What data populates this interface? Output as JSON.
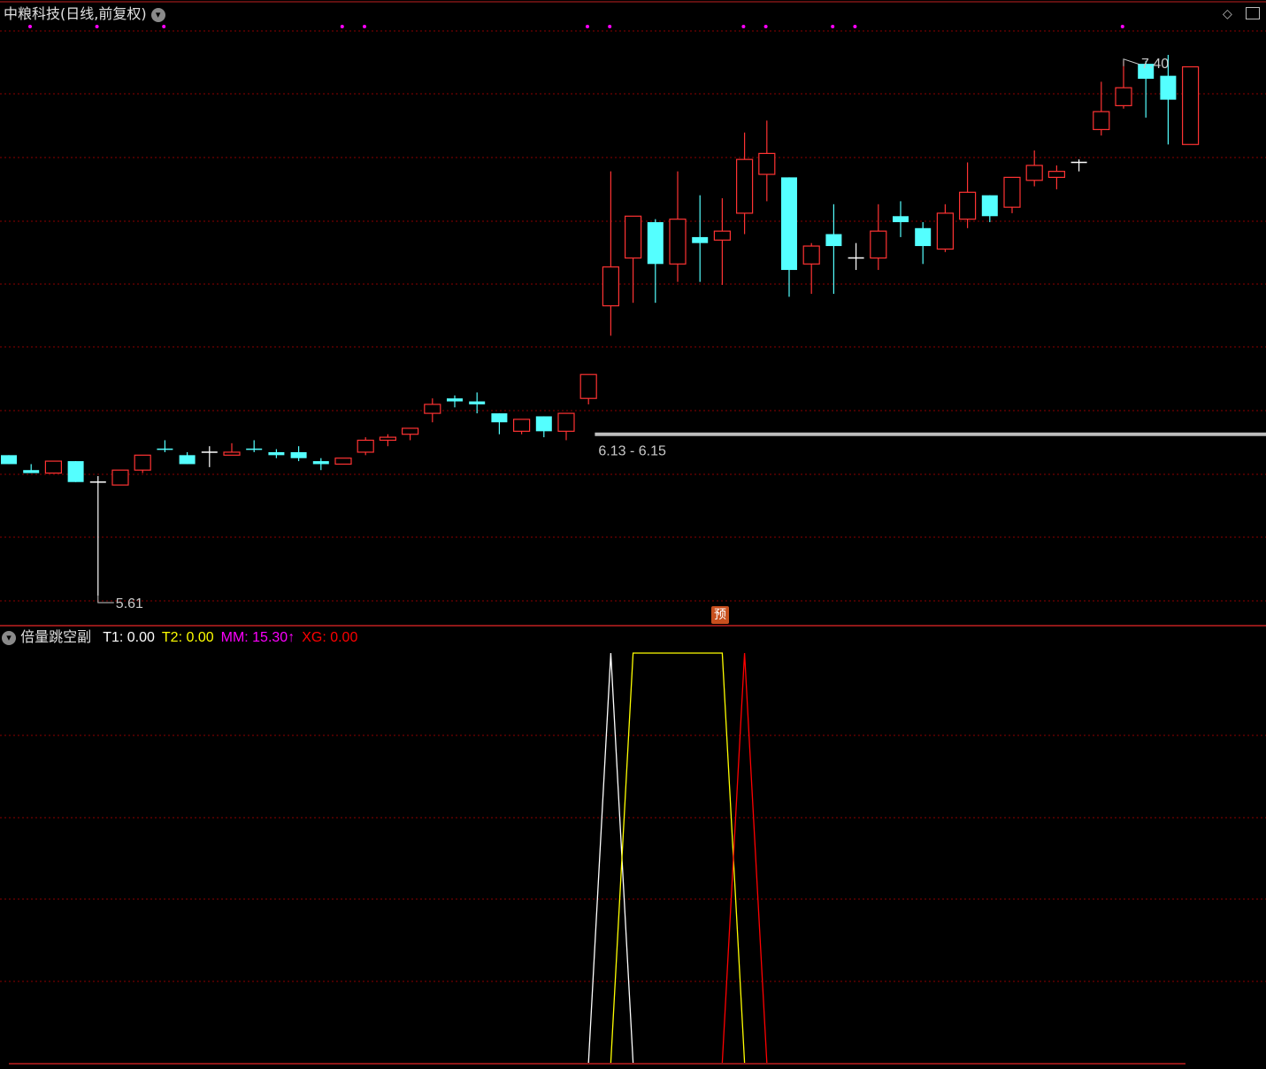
{
  "header": {
    "title": "中粮科技(日线,前复权)",
    "menu_icon": "chevron-down-icon",
    "right_icons": [
      "diamond-icon",
      "window-icon"
    ]
  },
  "indicator": {
    "name": "倍量跳空副",
    "items": [
      {
        "label": "T1",
        "value": "0.00",
        "color": "#ffffff"
      },
      {
        "label": "T2",
        "value": "0.00",
        "color": "#ffff00"
      },
      {
        "label": "MM",
        "value": "15.30",
        "color": "#ff00ff",
        "arrow": "↑"
      },
      {
        "label": "XG",
        "value": "0.00",
        "color": "#ff0000"
      }
    ]
  },
  "prediction_badge": "预",
  "colors": {
    "up": "#ff3333",
    "down": "#54ffff",
    "doji": "#ffffff",
    "grid": "#8b0000",
    "border": "#c02020",
    "support": "#bdbdbd",
    "dots": "#ff00ff"
  },
  "chart_data": [
    {
      "type": "candlestick",
      "title": "中粮科技(日线,前复权)",
      "annotations": [
        {
          "text": "5.61",
          "kind": "low"
        },
        {
          "text": "7.40",
          "kind": "high"
        },
        {
          "text": "6.13 - 6.15",
          "kind": "gap-support"
        }
      ],
      "support_level": 6.15,
      "ylim": [
        5.53,
        7.5
      ],
      "signal_dot_indices": [
        0,
        3,
        6,
        14,
        15,
        25,
        26,
        32,
        33,
        36,
        37,
        49
      ],
      "candles": [
        {
          "o": 6.08,
          "h": 6.08,
          "l": 6.05,
          "c": 6.05,
          "color": "down"
        },
        {
          "o": 6.03,
          "h": 6.05,
          "l": 6.02,
          "c": 6.02,
          "color": "down"
        },
        {
          "o": 6.02,
          "h": 6.06,
          "l": 6.02,
          "c": 6.06,
          "color": "up"
        },
        {
          "o": 6.06,
          "h": 6.06,
          "l": 5.99,
          "c": 5.99,
          "color": "down"
        },
        {
          "o": 5.99,
          "h": 6.01,
          "l": 5.61,
          "c": 5.99,
          "color": "doji"
        },
        {
          "o": 5.98,
          "h": 6.03,
          "l": 5.98,
          "c": 6.03,
          "color": "up"
        },
        {
          "o": 6.03,
          "h": 6.08,
          "l": 6.02,
          "c": 6.08,
          "color": "up"
        },
        {
          "o": 6.1,
          "h": 6.13,
          "l": 6.09,
          "c": 6.1,
          "color": "down"
        },
        {
          "o": 6.08,
          "h": 6.09,
          "l": 6.05,
          "c": 6.05,
          "color": "down"
        },
        {
          "o": 6.09,
          "h": 6.11,
          "l": 6.04,
          "c": 6.09,
          "color": "doji"
        },
        {
          "o": 6.08,
          "h": 6.12,
          "l": 6.08,
          "c": 6.09,
          "color": "up"
        },
        {
          "o": 6.1,
          "h": 6.13,
          "l": 6.09,
          "c": 6.1,
          "color": "down"
        },
        {
          "o": 6.09,
          "h": 6.1,
          "l": 6.07,
          "c": 6.08,
          "color": "down"
        },
        {
          "o": 6.09,
          "h": 6.11,
          "l": 6.06,
          "c": 6.07,
          "color": "down"
        },
        {
          "o": 6.06,
          "h": 6.07,
          "l": 6.03,
          "c": 6.05,
          "color": "down"
        },
        {
          "o": 6.05,
          "h": 6.07,
          "l": 6.05,
          "c": 6.07,
          "color": "up"
        },
        {
          "o": 6.09,
          "h": 6.14,
          "l": 6.08,
          "c": 6.13,
          "color": "up"
        },
        {
          "o": 6.13,
          "h": 6.15,
          "l": 6.11,
          "c": 6.14,
          "color": "up"
        },
        {
          "o": 6.15,
          "h": 6.17,
          "l": 6.13,
          "c": 6.17,
          "color": "up"
        },
        {
          "o": 6.22,
          "h": 6.27,
          "l": 6.19,
          "c": 6.25,
          "color": "up"
        },
        {
          "o": 6.27,
          "h": 6.28,
          "l": 6.24,
          "c": 6.26,
          "color": "down"
        },
        {
          "o": 6.26,
          "h": 6.29,
          "l": 6.22,
          "c": 6.25,
          "color": "down"
        },
        {
          "o": 6.22,
          "h": 6.22,
          "l": 6.15,
          "c": 6.19,
          "color": "down"
        },
        {
          "o": 6.16,
          "h": 6.2,
          "l": 6.15,
          "c": 6.2,
          "color": "up"
        },
        {
          "o": 6.21,
          "h": 6.21,
          "l": 6.14,
          "c": 6.16,
          "color": "down"
        },
        {
          "o": 6.16,
          "h": 6.22,
          "l": 6.13,
          "c": 6.22,
          "color": "up"
        },
        {
          "o": 6.27,
          "h": 6.35,
          "l": 6.25,
          "c": 6.35,
          "color": "up"
        },
        {
          "o": 6.58,
          "h": 7.03,
          "l": 6.48,
          "c": 6.71,
          "color": "up"
        },
        {
          "o": 6.74,
          "h": 6.86,
          "l": 6.59,
          "c": 6.88,
          "color": "up"
        },
        {
          "o": 6.86,
          "h": 6.87,
          "l": 6.59,
          "c": 6.72,
          "color": "down"
        },
        {
          "o": 6.72,
          "h": 7.03,
          "l": 6.66,
          "c": 6.87,
          "color": "up"
        },
        {
          "o": 6.81,
          "h": 6.95,
          "l": 6.66,
          "c": 6.79,
          "color": "down"
        },
        {
          "o": 6.8,
          "h": 6.94,
          "l": 6.65,
          "c": 6.83,
          "color": "up"
        },
        {
          "o": 6.89,
          "h": 7.16,
          "l": 6.82,
          "c": 7.07,
          "color": "up"
        },
        {
          "o": 7.09,
          "h": 7.2,
          "l": 6.93,
          "c": 7.02,
          "color": "up"
        },
        {
          "o": 7.01,
          "h": 7.01,
          "l": 6.61,
          "c": 6.7,
          "color": "down"
        },
        {
          "o": 6.72,
          "h": 6.79,
          "l": 6.62,
          "c": 6.78,
          "color": "up"
        },
        {
          "o": 6.82,
          "h": 6.92,
          "l": 6.62,
          "c": 6.78,
          "color": "down"
        },
        {
          "o": 6.74,
          "h": 6.79,
          "l": 6.7,
          "c": 6.74,
          "color": "doji"
        },
        {
          "o": 6.74,
          "h": 6.92,
          "l": 6.7,
          "c": 6.83,
          "color": "up"
        },
        {
          "o": 6.88,
          "h": 6.93,
          "l": 6.81,
          "c": 6.86,
          "color": "down"
        },
        {
          "o": 6.84,
          "h": 6.86,
          "l": 6.72,
          "c": 6.78,
          "color": "down"
        },
        {
          "o": 6.77,
          "h": 6.92,
          "l": 6.76,
          "c": 6.89,
          "color": "up"
        },
        {
          "o": 6.87,
          "h": 7.06,
          "l": 6.84,
          "c": 6.96,
          "color": "up"
        },
        {
          "o": 6.95,
          "h": 6.95,
          "l": 6.86,
          "c": 6.88,
          "color": "down"
        },
        {
          "o": 6.91,
          "h": 7.01,
          "l": 6.89,
          "c": 7.01,
          "color": "up"
        },
        {
          "o": 7.0,
          "h": 7.1,
          "l": 6.98,
          "c": 7.05,
          "color": "up"
        },
        {
          "o": 7.01,
          "h": 7.05,
          "l": 6.97,
          "c": 7.03,
          "color": "up"
        },
        {
          "o": 7.06,
          "h": 7.07,
          "l": 7.03,
          "c": 7.06,
          "color": "doji"
        },
        {
          "o": 7.17,
          "h": 7.33,
          "l": 7.15,
          "c": 7.23,
          "color": "up"
        },
        {
          "o": 7.25,
          "h": 7.4,
          "l": 7.24,
          "c": 7.31,
          "color": "up"
        },
        {
          "o": 7.39,
          "h": 7.4,
          "l": 7.21,
          "c": 7.34,
          "color": "down"
        },
        {
          "o": 7.35,
          "h": 7.42,
          "l": 7.12,
          "c": 7.27,
          "color": "down"
        },
        {
          "o": 7.12,
          "h": 7.28,
          "l": 7.16,
          "c": 7.38,
          "color": "up"
        }
      ]
    },
    {
      "type": "line",
      "title": "倍量跳空副",
      "ylim": [
        0,
        1
      ],
      "series": [
        {
          "name": "T1",
          "color": "#ffffff",
          "values": {
            "27": 1
          }
        },
        {
          "name": "T2",
          "color": "#ffff00",
          "values": {
            "28": 1,
            "29": 1,
            "30": 1,
            "31": 1,
            "32": 1
          }
        },
        {
          "name": "XG",
          "color": "#ff0000",
          "values": {
            "33": 1
          }
        }
      ]
    }
  ]
}
